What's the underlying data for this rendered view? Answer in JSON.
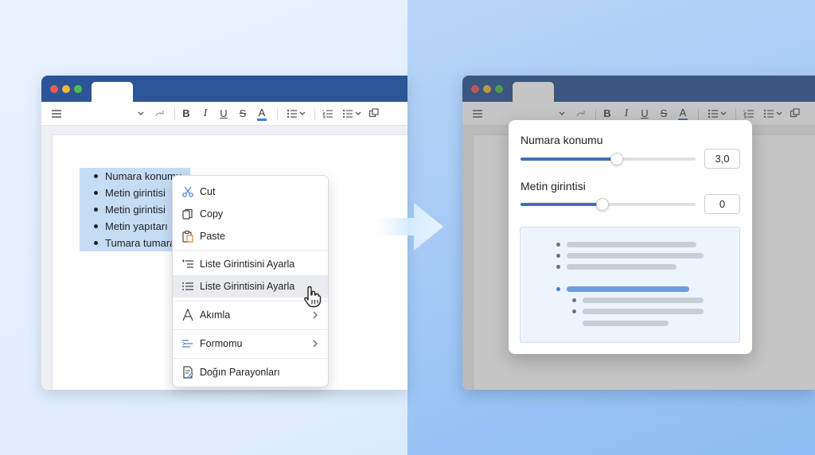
{
  "toolbar": {
    "buttons": {
      "bold": "B",
      "italic": "I",
      "underline": "U",
      "strike": "S",
      "font_color": "A"
    },
    "font_color_hex": "#3d7fe0"
  },
  "document": {
    "bullets": [
      "Numara konumu",
      "Metin girintisi",
      "Metin girintisi",
      "Metin yapıtarı",
      "Tumara tumara"
    ]
  },
  "context_menu": {
    "items": [
      {
        "label": "Cut",
        "icon": "scissors-icon"
      },
      {
        "label": "Copy",
        "icon": "copy-icon"
      },
      {
        "label": "Paste",
        "icon": "paste-icon"
      },
      {
        "label": "Liste Girintisini Ayarla",
        "icon": "list-indent-icon"
      },
      {
        "label": "Liste Girintisini Ayarla",
        "icon": "list-icon",
        "hovered": true
      },
      {
        "label": "Akımla",
        "icon": "font-icon",
        "submenu": true
      },
      {
        "label": "Formomu",
        "icon": "format-icon",
        "submenu": true
      },
      {
        "label": "Doğın Parayonları",
        "icon": "document-edit-icon"
      }
    ]
  },
  "indent_panel": {
    "number_position": {
      "label": "Numara konumu",
      "value": "3,0",
      "level": 0.55
    },
    "text_indent": {
      "label": "Metin girintisi",
      "value": "0",
      "level": 0.47
    }
  },
  "colors": {
    "titlebar": "#2c5597",
    "accent": "#3d6fc0",
    "selection": "#c5dcf5"
  }
}
